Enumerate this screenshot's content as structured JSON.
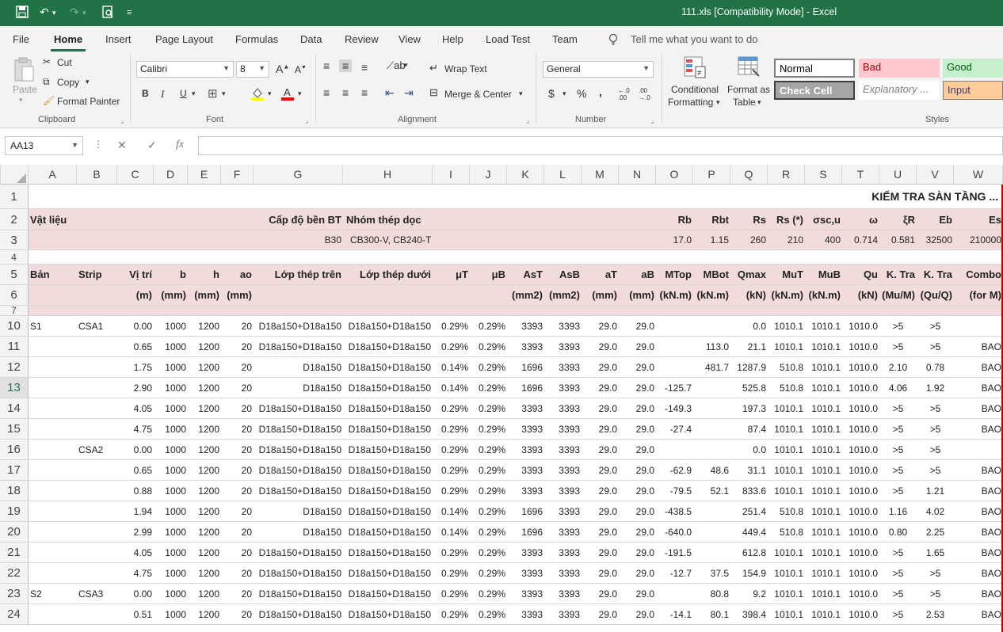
{
  "window": {
    "title": "111.xls  [Compatibility Mode]  -  Excel"
  },
  "quick_access": {
    "save_icon": "save-icon",
    "undo_icon": "undo-icon",
    "redo_icon": "redo-icon",
    "print_preview_icon": "print-preview-icon",
    "customize_icon": "customize-qat-icon"
  },
  "menu_tabs": [
    "File",
    "Home",
    "Insert",
    "Page Layout",
    "Formulas",
    "Data",
    "Review",
    "View",
    "Help",
    "Load Test",
    "Team"
  ],
  "tell_me": "Tell me what you want to do",
  "ribbon": {
    "clipboard": {
      "paste": "Paste",
      "cut": "Cut",
      "copy": "Copy",
      "format_painter": "Format Painter",
      "label": "Clipboard"
    },
    "font": {
      "name": "Calibri",
      "size": "8",
      "bold": "B",
      "italic": "I",
      "underline": "U",
      "label": "Font"
    },
    "alignment": {
      "wrap_text": "Wrap Text",
      "merge_center": "Merge & Center",
      "label": "Alignment"
    },
    "number": {
      "format": "General",
      "currency": "$",
      "percent": "%",
      "comma": ",",
      "inc_decimal": "←.0 .00",
      "dec_decimal": ".00 →.0",
      "label": "Number"
    },
    "styles": {
      "conditional_formatting": [
        "Conditional",
        "Formatting"
      ],
      "format_as_table": [
        "Format as",
        "Table"
      ],
      "normal": "Normal",
      "bad": "Bad",
      "good": "Good",
      "check_cell": "Check Cell",
      "explanatory": "Explanatory ...",
      "input": "Input",
      "label": "Styles",
      "colors": {
        "normal_bg": "#ffffff",
        "bad_bg": "#ffc7ce",
        "bad_fg": "#9c0006",
        "good_bg": "#c6efce",
        "good_fg": "#006100",
        "check_bg": "#a5a5a5",
        "input_bg": "#ffcc99",
        "input_fg": "#3f3f76"
      }
    }
  },
  "formula_bar": {
    "name_box": "AA13",
    "fx": "fx",
    "cancel": "✕",
    "enter": "✓",
    "value": ""
  },
  "columns": [
    "A",
    "B",
    "C",
    "D",
    "E",
    "F",
    "G",
    "H",
    "I",
    "J",
    "K",
    "L",
    "M",
    "N",
    "O",
    "P",
    "Q",
    "R",
    "S",
    "T",
    "U",
    "V",
    "W"
  ],
  "sheet": {
    "title": "KIỂM TRA SÀN TẦNG ...",
    "row2": {
      "vat_lieu": "Vật liệu",
      "cap_do": "Cấp độ bền BT",
      "nhom_thep": "Nhóm thép dọc",
      "Rb": "Rb",
      "Rbt": "Rbt",
      "Rs": "Rs",
      "Rs2": "Rs (*)",
      "sigma": "σsc,u",
      "omega": "ω",
      "xi": "ξR",
      "Eb": "Eb",
      "Es": "Es"
    },
    "row3": {
      "grade": "B30",
      "steel": "CB300-V, CB240-T",
      "Rb": "17.0",
      "Rbt": "1.15",
      "Rs": "260",
      "Rs2": "210",
      "sigma": "400",
      "omega": "0.714",
      "xi": "0.581",
      "Eb": "32500",
      "Es": "210000"
    },
    "header5": [
      "Bản",
      "Strip",
      "Vị trí",
      "b",
      "h",
      "ao",
      "Lớp thép trên",
      "Lớp thép dưới",
      "μT",
      "μB",
      "AsT",
      "AsB",
      "aT",
      "aB",
      "MTop",
      "MBot",
      "Qmax",
      "MuT",
      "MuB",
      "Qu",
      "K. Tra",
      "K. Tra",
      "Combo"
    ],
    "header6": [
      "",
      "",
      "(m)",
      "(mm)",
      "(mm)",
      "(mm)",
      "",
      "",
      "",
      "",
      "(mm2)",
      "(mm2)",
      "(mm)",
      "(mm)",
      "(kN.m)",
      "(kN.m)",
      "(kN)",
      "(kN.m)",
      "(kN.m)",
      "(kN)",
      "(Mu/M)",
      "(Qu/Q)",
      "(for M)"
    ],
    "row_numbers": [
      "1",
      "2",
      "3",
      "4",
      "5",
      "6",
      "7",
      "10",
      "11",
      "12",
      "13",
      "14",
      "15",
      "16",
      "17",
      "18",
      "19",
      "20",
      "21",
      "22",
      "23",
      "24"
    ],
    "data_rows": [
      [
        "S1",
        "CSA1",
        "0.00",
        "1000",
        "1200",
        "20",
        "D18a150+D18a150",
        "D18a150+D18a150",
        "0.29%",
        "0.29%",
        "3393",
        "3393",
        "29.0",
        "29.0",
        "",
        "",
        "0.0",
        "1010.1",
        "1010.1",
        "1010.0",
        ">5",
        ">5",
        ""
      ],
      [
        "",
        "",
        "0.65",
        "1000",
        "1200",
        "20",
        "D18a150+D18a150",
        "D18a150+D18a150",
        "0.29%",
        "0.29%",
        "3393",
        "3393",
        "29.0",
        "29.0",
        "",
        "113.0",
        "21.1",
        "1010.1",
        "1010.1",
        "1010.0",
        ">5",
        ">5",
        "BAO"
      ],
      [
        "",
        "",
        "1.75",
        "1000",
        "1200",
        "20",
        "D18a150",
        "D18a150+D18a150",
        "0.14%",
        "0.29%",
        "1696",
        "3393",
        "29.0",
        "29.0",
        "",
        "481.7",
        "1287.9",
        "510.8",
        "1010.1",
        "1010.0",
        "2.10",
        "0.78",
        "BAO"
      ],
      [
        "",
        "",
        "2.90",
        "1000",
        "1200",
        "20",
        "D18a150",
        "D18a150+D18a150",
        "0.14%",
        "0.29%",
        "1696",
        "3393",
        "29.0",
        "29.0",
        "-125.7",
        "",
        "525.8",
        "510.8",
        "1010.1",
        "1010.0",
        "4.06",
        "1.92",
        "BAO"
      ],
      [
        "",
        "",
        "4.05",
        "1000",
        "1200",
        "20",
        "D18a150+D18a150",
        "D18a150+D18a150",
        "0.29%",
        "0.29%",
        "3393",
        "3393",
        "29.0",
        "29.0",
        "-149.3",
        "",
        "197.3",
        "1010.1",
        "1010.1",
        "1010.0",
        ">5",
        ">5",
        "BAO"
      ],
      [
        "",
        "",
        "4.75",
        "1000",
        "1200",
        "20",
        "D18a150+D18a150",
        "D18a150+D18a150",
        "0.29%",
        "0.29%",
        "3393",
        "3393",
        "29.0",
        "29.0",
        "-27.4",
        "",
        "87.4",
        "1010.1",
        "1010.1",
        "1010.0",
        ">5",
        ">5",
        "BAO"
      ],
      [
        "",
        "CSA2",
        "0.00",
        "1000",
        "1200",
        "20",
        "D18a150+D18a150",
        "D18a150+D18a150",
        "0.29%",
        "0.29%",
        "3393",
        "3393",
        "29.0",
        "29.0",
        "",
        "",
        "0.0",
        "1010.1",
        "1010.1",
        "1010.0",
        ">5",
        ">5",
        ""
      ],
      [
        "",
        "",
        "0.65",
        "1000",
        "1200",
        "20",
        "D18a150+D18a150",
        "D18a150+D18a150",
        "0.29%",
        "0.29%",
        "3393",
        "3393",
        "29.0",
        "29.0",
        "-62.9",
        "48.6",
        "31.1",
        "1010.1",
        "1010.1",
        "1010.0",
        ">5",
        ">5",
        "BAO"
      ],
      [
        "",
        "",
        "0.88",
        "1000",
        "1200",
        "20",
        "D18a150+D18a150",
        "D18a150+D18a150",
        "0.29%",
        "0.29%",
        "3393",
        "3393",
        "29.0",
        "29.0",
        "-79.5",
        "52.1",
        "833.6",
        "1010.1",
        "1010.1",
        "1010.0",
        ">5",
        "1.21",
        "BAO"
      ],
      [
        "",
        "",
        "1.94",
        "1000",
        "1200",
        "20",
        "D18a150",
        "D18a150+D18a150",
        "0.14%",
        "0.29%",
        "1696",
        "3393",
        "29.0",
        "29.0",
        "-438.5",
        "",
        "251.4",
        "510.8",
        "1010.1",
        "1010.0",
        "1.16",
        "4.02",
        "BAO"
      ],
      [
        "",
        "",
        "2.99",
        "1000",
        "1200",
        "20",
        "D18a150",
        "D18a150+D18a150",
        "0.14%",
        "0.29%",
        "1696",
        "3393",
        "29.0",
        "29.0",
        "-640.0",
        "",
        "449.4",
        "510.8",
        "1010.1",
        "1010.0",
        "0.80",
        "2.25",
        "BAO"
      ],
      [
        "",
        "",
        "4.05",
        "1000",
        "1200",
        "20",
        "D18a150+D18a150",
        "D18a150+D18a150",
        "0.29%",
        "0.29%",
        "3393",
        "3393",
        "29.0",
        "29.0",
        "-191.5",
        "",
        "612.8",
        "1010.1",
        "1010.1",
        "1010.0",
        ">5",
        "1.65",
        "BAO"
      ],
      [
        "",
        "",
        "4.75",
        "1000",
        "1200",
        "20",
        "D18a150+D18a150",
        "D18a150+D18a150",
        "0.29%",
        "0.29%",
        "3393",
        "3393",
        "29.0",
        "29.0",
        "-12.7",
        "37.5",
        "154.9",
        "1010.1",
        "1010.1",
        "1010.0",
        ">5",
        ">5",
        "BAO"
      ],
      [
        "S2",
        "CSA3",
        "0.00",
        "1000",
        "1200",
        "20",
        "D18a150+D18a150",
        "D18a150+D18a150",
        "0.29%",
        "0.29%",
        "3393",
        "3393",
        "29.0",
        "29.0",
        "",
        "80.8",
        "9.2",
        "1010.1",
        "1010.1",
        "1010.0",
        ">5",
        ">5",
        "BAO"
      ],
      [
        "",
        "",
        "0.51",
        "1000",
        "1200",
        "20",
        "D18a150+D18a150",
        "D18a150+D18a150",
        "0.29%",
        "0.29%",
        "3393",
        "3393",
        "29.0",
        "29.0",
        "-14.1",
        "80.1",
        "398.4",
        "1010.1",
        "1010.1",
        "1010.0",
        ">5",
        "2.53",
        "BAO"
      ]
    ]
  }
}
